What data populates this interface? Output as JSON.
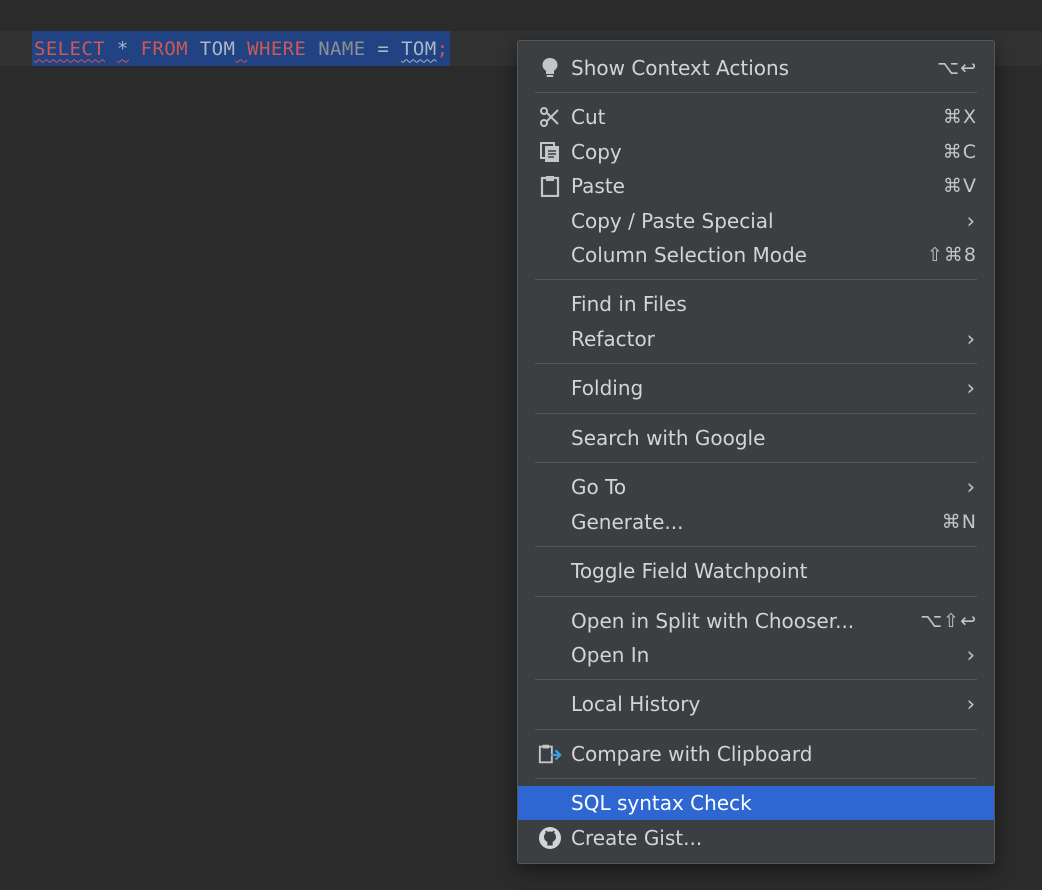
{
  "editor": {
    "tokens": [
      {
        "text": "SELECT",
        "kind": "keyword",
        "squiggle": "red"
      },
      {
        "text": " ",
        "kind": "plain",
        "squiggle": ""
      },
      {
        "text": "*",
        "kind": "plain",
        "squiggle": "red"
      },
      {
        "text": " ",
        "kind": "plain",
        "squiggle": ""
      },
      {
        "text": "FROM",
        "kind": "keyword",
        "squiggle": ""
      },
      {
        "text": " ",
        "kind": "plain",
        "squiggle": ""
      },
      {
        "text": "TOM",
        "kind": "plain",
        "squiggle": ""
      },
      {
        "text": " ",
        "kind": "plain",
        "squiggle": "red"
      },
      {
        "text": "WHERE",
        "kind": "keyword",
        "squiggle": ""
      },
      {
        "text": " ",
        "kind": "plain",
        "squiggle": ""
      },
      {
        "text": "NAME",
        "kind": "muted",
        "squiggle": ""
      },
      {
        "text": " = ",
        "kind": "plain",
        "squiggle": ""
      },
      {
        "text": "TOM",
        "kind": "plain",
        "squiggle": "blue"
      },
      {
        "text": ";",
        "kind": "keyword",
        "squiggle": ""
      }
    ]
  },
  "menu": {
    "show_context_actions": {
      "label": "Show Context Actions",
      "shortcut": "⌥↩",
      "icon": "lightbulb-icon"
    },
    "cut": {
      "label": "Cut",
      "shortcut": "⌘X",
      "icon": "scissors-icon"
    },
    "copy": {
      "label": "Copy",
      "shortcut": "⌘C",
      "icon": "copy-icon"
    },
    "paste": {
      "label": "Paste",
      "shortcut": "⌘V",
      "icon": "clipboard-icon"
    },
    "copy_paste_special": {
      "label": "Copy / Paste Special"
    },
    "column_selection_mode": {
      "label": "Column Selection Mode",
      "shortcut": "⇧⌘8"
    },
    "find_in_files": {
      "label": "Find in Files"
    },
    "refactor": {
      "label": "Refactor"
    },
    "folding": {
      "label": "Folding"
    },
    "search_with_google": {
      "label": "Search with Google"
    },
    "go_to": {
      "label": "Go To"
    },
    "generate": {
      "label": "Generate...",
      "shortcut": "⌘N"
    },
    "toggle_field_watchpoint": {
      "label": "Toggle Field Watchpoint"
    },
    "open_in_split": {
      "label": "Open in Split with Chooser...",
      "shortcut": "⌥⇧↩"
    },
    "open_in": {
      "label": "Open In"
    },
    "local_history": {
      "label": "Local History"
    },
    "compare_with_clipboard": {
      "label": "Compare with Clipboard",
      "icon": "compare-clipboard-icon"
    },
    "sql_syntax_check": {
      "label": "SQL syntax Check"
    },
    "create_gist": {
      "label": "Create Gist...",
      "icon": "github-icon"
    },
    "submenu_arrow": "›"
  },
  "colors": {
    "editor_bg": "#2b2b2b",
    "selection": "#214283",
    "menu_bg": "#3c3f41",
    "highlight": "#2e67d2",
    "keyword": "#cc5a54"
  }
}
